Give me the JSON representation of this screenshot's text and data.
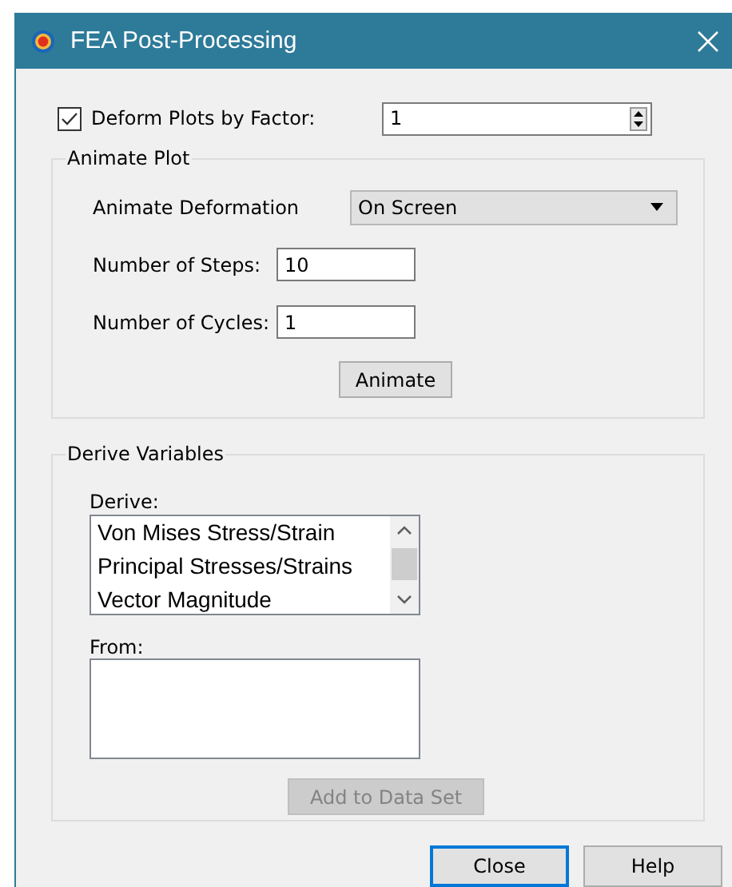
{
  "window": {
    "title": "FEA Post-Processing"
  },
  "deform": {
    "label": "Deform Plots by Factor:",
    "checked": true,
    "value": "1"
  },
  "animate_plot": {
    "title": "Animate Plot",
    "fields": [
      {
        "kind": "dropdown",
        "label": "Animate Deformation",
        "value": "On Screen"
      },
      {
        "kind": "text",
        "label": "Number of Steps:",
        "value": "10"
      },
      {
        "kind": "text",
        "label": "Number of Cycles:",
        "value": "1"
      }
    ],
    "button": {
      "label": "Animate",
      "disabled": false
    }
  },
  "derive_variables": {
    "title": "Derive Variables",
    "derive_label": "Derive:",
    "derive_items": [
      {
        "label": "Von Mises Stress/Strain",
        "selected": false
      },
      {
        "label": "Principal Stresses/Strains",
        "selected": false
      },
      {
        "label": "Vector Magnitude",
        "selected": false
      }
    ],
    "from_label": "From:",
    "button": {
      "label": "Add to Data Set",
      "disabled": true
    }
  },
  "buttons": [
    {
      "label": "Close",
      "focused": true
    },
    {
      "label": "Help",
      "focused": false
    }
  ]
}
